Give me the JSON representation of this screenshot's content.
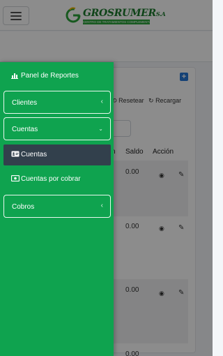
{
  "header": {
    "logo": {
      "brand": "GROSRUMER",
      "suffix": "S.A",
      "tagline": "CENTRO DE TRATAMIENTOS COMPLEMENTARIOS"
    }
  },
  "toolbar": {
    "reset_label": "Resetear",
    "reload_label": "Recargar"
  },
  "table": {
    "columns": [
      "n",
      "Saldo",
      "Acción"
    ],
    "rows": [
      {
        "saldo": "0.00"
      },
      {
        "saldo": "0.00"
      },
      {
        "saldo": "0.00"
      },
      {
        "saldo": "0.00"
      }
    ]
  },
  "sidebar": {
    "items": [
      {
        "label": "Panel de Reportes",
        "icon": "bar-chart-icon"
      },
      {
        "label": "Clientes",
        "icon": "chevron-left-icon"
      },
      {
        "label": "Cuentas",
        "icon": "chevron-down-icon",
        "children": [
          {
            "label": "Cuentas",
            "icon": "id-card-icon",
            "active": true
          },
          {
            "label": "Cuentas por cobrar",
            "icon": "money-bill-icon"
          }
        ]
      },
      {
        "label": "Cobros",
        "icon": "chevron-left-icon"
      }
    ]
  },
  "colors": {
    "sidebar_bg": "#0fa34f",
    "active_sub_bg": "#32404c",
    "brand_green": "#1b7a2c",
    "primary_blue": "#2779d8"
  }
}
